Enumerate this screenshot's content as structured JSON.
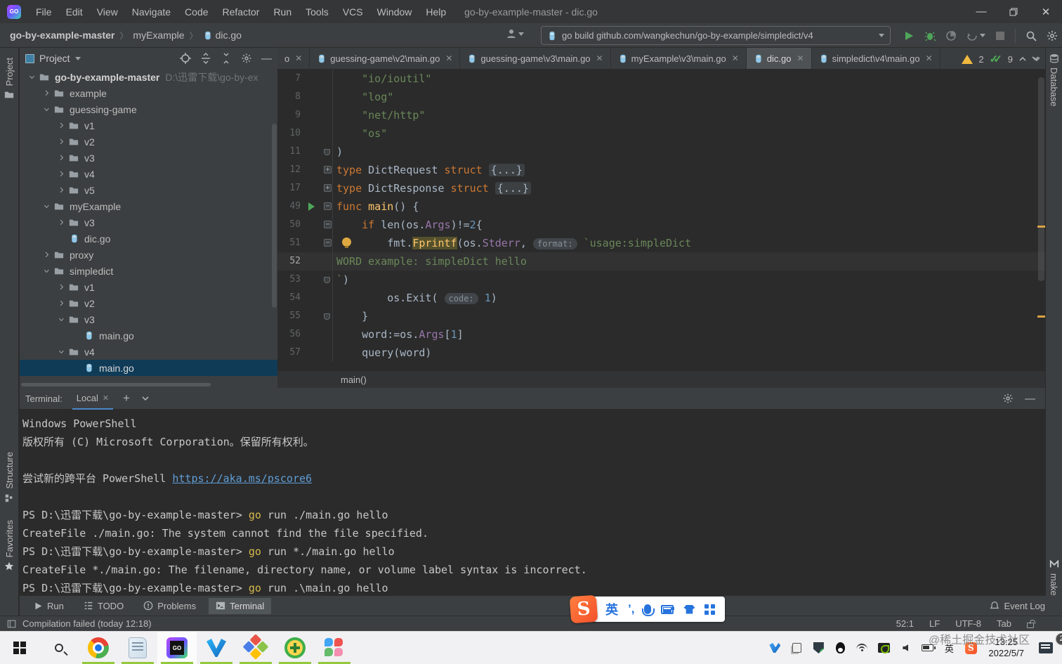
{
  "window": {
    "title": "go-by-example-master - dic.go",
    "controls": [
      "minimize",
      "restore",
      "close"
    ]
  },
  "menu": {
    "items": [
      "File",
      "Edit",
      "View",
      "Navigate",
      "Code",
      "Refactor",
      "Run",
      "Tools",
      "VCS",
      "Window",
      "Help"
    ]
  },
  "breadcrumbs": {
    "items": [
      "go-by-example-master",
      "myExample",
      "dic.go"
    ]
  },
  "toolbar": {
    "run_config": "go build github.com/wangkechun/go-by-example/simpledict/v4"
  },
  "left_strip": {
    "project": "Project",
    "structure": "Structure",
    "favorites": "Favorites"
  },
  "right_strip": {
    "database": "Database",
    "make": "make"
  },
  "project_panel": {
    "title": "Project",
    "tree": [
      {
        "indent": 0,
        "chev": "open",
        "icon": "folder",
        "label": "go-by-example-master",
        "bold": true,
        "path": "D:\\迅雷下载\\go-by-ex"
      },
      {
        "indent": 1,
        "chev": "closed",
        "icon": "folder",
        "label": "example"
      },
      {
        "indent": 1,
        "chev": "open",
        "icon": "folder",
        "label": "guessing-game"
      },
      {
        "indent": 2,
        "chev": "closed",
        "icon": "folder",
        "label": "v1"
      },
      {
        "indent": 2,
        "chev": "closed",
        "icon": "folder",
        "label": "v2"
      },
      {
        "indent": 2,
        "chev": "closed",
        "icon": "folder",
        "label": "v3"
      },
      {
        "indent": 2,
        "chev": "closed",
        "icon": "folder",
        "label": "v4"
      },
      {
        "indent": 2,
        "chev": "closed",
        "icon": "folder",
        "label": "v5"
      },
      {
        "indent": 1,
        "chev": "open",
        "icon": "folder",
        "label": "myExample"
      },
      {
        "indent": 2,
        "chev": "closed",
        "icon": "folder",
        "label": "v3"
      },
      {
        "indent": 2,
        "chev": null,
        "icon": "go",
        "label": "dic.go"
      },
      {
        "indent": 1,
        "chev": "closed",
        "icon": "folder",
        "label": "proxy"
      },
      {
        "indent": 1,
        "chev": "open",
        "icon": "folder",
        "label": "simpledict"
      },
      {
        "indent": 2,
        "chev": "closed",
        "icon": "folder",
        "label": "v1"
      },
      {
        "indent": 2,
        "chev": "closed",
        "icon": "folder",
        "label": "v2"
      },
      {
        "indent": 2,
        "chev": "open",
        "icon": "folder",
        "label": "v3"
      },
      {
        "indent": 3,
        "chev": null,
        "icon": "go",
        "label": "main.go"
      },
      {
        "indent": 2,
        "chev": "open",
        "icon": "folder",
        "label": "v4"
      },
      {
        "indent": 3,
        "chev": null,
        "icon": "go",
        "label": "main.go",
        "selected": true
      }
    ]
  },
  "editor_tabs": [
    {
      "label": "o",
      "partial": true
    },
    {
      "label": "guessing-game\\v2\\main.go"
    },
    {
      "label": "guessing-game\\v3\\main.go"
    },
    {
      "label": "myExample\\v3\\main.go"
    },
    {
      "label": "dic.go",
      "active": true
    },
    {
      "label": "simpledict\\v4\\main.go"
    }
  ],
  "editor": {
    "inspections": {
      "warnings": "2",
      "passed": "9"
    },
    "breadcrumb": "main()",
    "lines": [
      {
        "n": "7",
        "segs": [
          [
            "    \"io/ioutil\"",
            "str"
          ]
        ]
      },
      {
        "n": "8",
        "segs": [
          [
            "    \"log\"",
            "str"
          ]
        ]
      },
      {
        "n": "9",
        "segs": [
          [
            "    \"net/http\"",
            "str"
          ]
        ]
      },
      {
        "n": "10",
        "segs": [
          [
            "    \"os\"",
            "str"
          ]
        ]
      },
      {
        "n": "11",
        "fold": "end",
        "segs": [
          [
            ")"
          ]
        ]
      },
      {
        "n": "12",
        "fold": "plus",
        "segs": [
          [
            "type ",
            "kw"
          ],
          [
            "DictRequest "
          ],
          [
            "struct ",
            "kw"
          ],
          [
            "{...}",
            "fold"
          ]
        ]
      },
      {
        "n": "17",
        "fold": "plus",
        "segs": [
          [
            "type ",
            "kw"
          ],
          [
            "DictResponse "
          ],
          [
            "struct ",
            "kw"
          ],
          [
            "{...}",
            "fold"
          ]
        ]
      },
      {
        "n": "49",
        "fold": "minus",
        "run": true,
        "segs": [
          [
            "func ",
            "kw"
          ],
          [
            "main",
            "fn"
          ],
          [
            "() {"
          ]
        ]
      },
      {
        "n": "50",
        "fold": "minus",
        "segs": [
          [
            "    "
          ],
          [
            "if ",
            "kw"
          ],
          [
            "len(os."
          ],
          [
            "Args",
            "field"
          ],
          [
            ")!="
          ],
          [
            "2",
            "num"
          ],
          [
            "{"
          ]
        ]
      },
      {
        "n": "51",
        "fold": "minus",
        "bulb": true,
        "segs": [
          [
            "        fmt."
          ],
          [
            "Fprintf",
            "hlfn"
          ],
          [
            "(os."
          ],
          [
            "Stderr",
            "field"
          ],
          [
            ", "
          ],
          [
            "format:",
            "hint"
          ],
          [
            " "
          ],
          [
            "`usage:simpleDict",
            "str"
          ]
        ]
      },
      {
        "n": "52",
        "cur": true,
        "segs": [
          [
            "WORD example: simpleDict hello",
            "str"
          ]
        ]
      },
      {
        "n": "53",
        "fold": "end",
        "segs": [
          [
            "`",
            "str"
          ],
          [
            ")"
          ]
        ]
      },
      {
        "n": "54",
        "segs": [
          [
            "        os.Exit( "
          ],
          [
            "code:",
            "hint"
          ],
          [
            " "
          ],
          [
            "1",
            "num"
          ],
          [
            ")"
          ]
        ]
      },
      {
        "n": "55",
        "fold": "end",
        "segs": [
          [
            "    }"
          ]
        ]
      },
      {
        "n": "56",
        "segs": [
          [
            "    word:=os."
          ],
          [
            "Args",
            "field"
          ],
          [
            "["
          ],
          [
            "1",
            "num"
          ],
          [
            "]"
          ]
        ]
      },
      {
        "n": "57",
        "segs": [
          [
            "    query(word)"
          ]
        ]
      }
    ]
  },
  "terminal": {
    "label": "Terminal:",
    "tab_label": "Local",
    "lines": [
      {
        "segs": [
          [
            "Windows PowerShell"
          ]
        ]
      },
      {
        "segs": [
          [
            "版权所有 (C) Microsoft Corporation。保留所有权利。"
          ]
        ]
      },
      {
        "segs": [
          [
            ""
          ]
        ]
      },
      {
        "segs": [
          [
            "尝试新的跨平台 PowerShell "
          ],
          [
            "https://aka.ms/pscore6",
            "link"
          ]
        ]
      },
      {
        "segs": [
          [
            ""
          ]
        ]
      },
      {
        "segs": [
          [
            "PS D:\\迅雷下载\\go-by-example-master> "
          ],
          [
            "go",
            "y"
          ],
          [
            " run ./main.go hello"
          ]
        ]
      },
      {
        "segs": [
          [
            "CreateFile ./main.go: The system cannot find the file specified."
          ]
        ]
      },
      {
        "segs": [
          [
            "PS D:\\迅雷下载\\go-by-example-master> "
          ],
          [
            "go",
            "y"
          ],
          [
            " run *./main.go hello"
          ]
        ]
      },
      {
        "segs": [
          [
            "CreateFile *./main.go: The filename, directory name, or volume label syntax is incorrect."
          ]
        ]
      },
      {
        "segs": [
          [
            "PS D:\\迅雷下载\\go-by-example-master> "
          ],
          [
            "go",
            "y"
          ],
          [
            " run .\\main.go hello"
          ]
        ]
      }
    ]
  },
  "bottom_bar": {
    "items": [
      {
        "label": "Run",
        "icon": "run"
      },
      {
        "label": "TODO",
        "icon": "todo"
      },
      {
        "label": "Problems",
        "icon": "problems"
      },
      {
        "label": "Terminal",
        "icon": "terminal",
        "active": true
      }
    ],
    "event_log": "Event Log"
  },
  "status_bar": {
    "message": "Compilation failed (today 12:18)",
    "position": "52:1",
    "line_ending": "LF",
    "encoding": "UTF-8",
    "indent": "Tab"
  },
  "ime": {
    "logo": "S",
    "lang": "英",
    "punctuation": "’,"
  },
  "taskbar": {
    "apps": [
      {
        "name": "start"
      },
      {
        "name": "search"
      },
      {
        "name": "chrome",
        "running": true
      },
      {
        "name": "notepad",
        "running": true
      },
      {
        "name": "goland",
        "running": true,
        "active": true
      },
      {
        "name": "blue-v-app",
        "running": true
      },
      {
        "name": "diamond-app",
        "running": true
      },
      {
        "name": "360-safeguard",
        "running": true
      },
      {
        "name": "flower-app",
        "running": true
      }
    ],
    "tray": [
      "thunder",
      "clipboard",
      "defender",
      "qq",
      "wifi",
      "nvidia",
      "volume",
      "battery-plug",
      "ime-lang",
      "sogou"
    ],
    "tray_lang": "英",
    "clock_time": "13:25",
    "clock_date": "2022/5/7",
    "notification_count": "2"
  },
  "watermark": "@稀土掘金技术社区",
  "colors": {
    "selection": "#0f3b57",
    "keyword": "#cc7832",
    "string": "#6a8759",
    "number": "#6897bb",
    "link": "#5f9ed6",
    "warning": "#f2b93f",
    "run_green": "#4fa65a",
    "taskbar_indicator": "#94c83d"
  }
}
